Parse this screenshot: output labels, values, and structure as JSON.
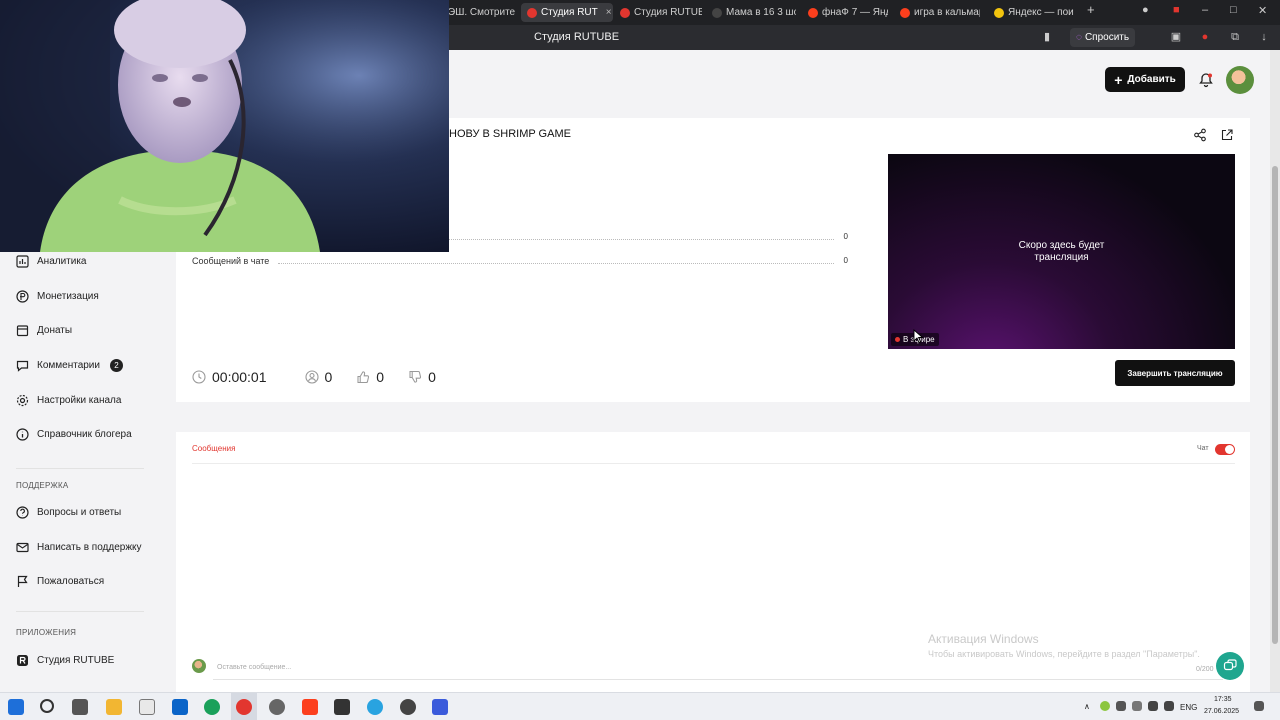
{
  "browser": {
    "tabs": [
      {
        "label": "ЭШ. Смотрите",
        "icon": "rutube-icon"
      },
      {
        "label": "Студия RUT",
        "icon": "rutube-studio-icon",
        "active": true
      },
      {
        "label": "Студия RUTUB",
        "icon": "rutube-studio-icon"
      },
      {
        "label": "Мама в 16 3 шо",
        "icon": "rutube-r-icon"
      },
      {
        "label": "фнаФ 7 — Янде",
        "icon": "yandex-icon"
      },
      {
        "label": "игра в кальмар",
        "icon": "yandex-icon"
      },
      {
        "label": "Яндекс — поис",
        "icon": "yandex-browser-icon"
      }
    ],
    "page_title": "Студия RUTUBE",
    "ask_label": "Спросить"
  },
  "header": {
    "add_label": "Добавить"
  },
  "sidebar": {
    "items": [
      {
        "label": "Аналитика",
        "icon": "analytics-icon"
      },
      {
        "label": "Монетизация",
        "icon": "monetization-icon"
      },
      {
        "label": "Донаты",
        "icon": "donations-icon"
      },
      {
        "label": "Комментарии",
        "icon": "comments-icon",
        "badge": "2"
      },
      {
        "label": "Настройки канала",
        "icon": "settings-icon"
      },
      {
        "label": "Справочник блогера",
        "icon": "guide-icon"
      }
    ],
    "support_heading": "ПОДДЕРЖКА",
    "support_items": [
      {
        "label": "Вопросы и ответы",
        "icon": "faq-icon"
      },
      {
        "label": "Написать в поддержку",
        "icon": "mail-icon"
      },
      {
        "label": "Пожаловаться",
        "icon": "flag-icon"
      }
    ],
    "apps_heading": "ПРИЛОЖЕНИЯ",
    "apps_items": [
      {
        "label": "Студия RUTUBE",
        "icon": "rutube-studio-icon"
      }
    ]
  },
  "stream": {
    "title": "НОВУ В SHRIMP GAME",
    "stats": [
      {
        "label": "",
        "value": "0"
      },
      {
        "label": "Сообщений в чате",
        "value": "0"
      }
    ],
    "player_text_line1": "Скоро здесь будет",
    "player_text_line2": "трансляция",
    "live_label": "В эфире",
    "duration": "00:00:01",
    "viewers": "0",
    "likes": "0",
    "dislikes": "0",
    "end_button": "Завершить трансляцию"
  },
  "chat": {
    "tab_label": "Сообщения",
    "toggle_label": "Чат",
    "toggle_on": true,
    "input_placeholder": "Оставьте сообщение...",
    "counter": "0/200"
  },
  "windows": {
    "activation_title": "Активация Windows",
    "activation_text": "Чтобы активировать Windows, перейдите в раздел \"Параметры\"."
  },
  "taskbar": {
    "language": "ENG",
    "time": "17:35",
    "date": "27.06.2025"
  },
  "colors": {
    "accent": "#e2362f",
    "primary_button": "#111111",
    "support_fab": "#1fa68f"
  }
}
